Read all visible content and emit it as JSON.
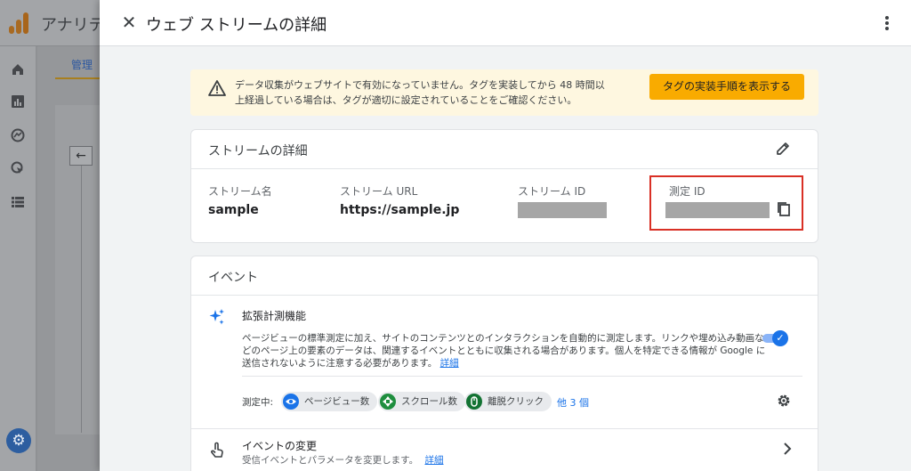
{
  "background": {
    "app_title": "アナリティクス",
    "tab_admin": "管理",
    "back_arrow": "←"
  },
  "drawer": {
    "close_icon": "✕",
    "title": "ウェブ ストリームの詳細"
  },
  "warning": {
    "text": "データ収集がウェブサイトで有効になっていません。タグを実装してから 48 時間以上経過している場合は、タグが適切に設定されていることをご確認ください。",
    "button_label": "タグの実装手順を表示する"
  },
  "stream_details": {
    "heading": "ストリームの詳細",
    "name_label": "ストリーム名",
    "name_value": "sample",
    "url_label": "ストリーム URL",
    "url_value": "https://sample.jp",
    "id_label": "ストリーム ID",
    "measurement_id_label": "測定 ID"
  },
  "events": {
    "heading": "イベント",
    "enhanced": {
      "title": "拡張計測機能",
      "description": "ページビューの標準測定に加え、サイトのコンテンツとのインタラクションを自動的に測定します。リンクや埋め込み動画などのページ上の要素のデータは、関連するイベントとともに収集される場合があります。個人を特定できる情報が Google に送信されないように注意する必要があります。",
      "details_link": "詳細",
      "toggle_on": true,
      "measuring_label": "測定中:",
      "chips": [
        {
          "label": "ページビュー数",
          "icon": "eye-icon",
          "color": "#1a73e8"
        },
        {
          "label": "スクロール数",
          "icon": "crosshair-icon",
          "color": "#1e8e3e"
        },
        {
          "label": "離脱クリック",
          "icon": "cursor-icon",
          "color": "#137333"
        }
      ],
      "more_label": "他 3 個"
    },
    "modify": {
      "title": "イベントの変更",
      "subtitle": "受信イベントとパラメータを変更します。",
      "details_link": "詳細"
    }
  },
  "colors": {
    "warning_bg": "#fef7e0",
    "warning_button": "#f9ab00",
    "highlight": "#d93025",
    "accent": "#1a73e8"
  }
}
